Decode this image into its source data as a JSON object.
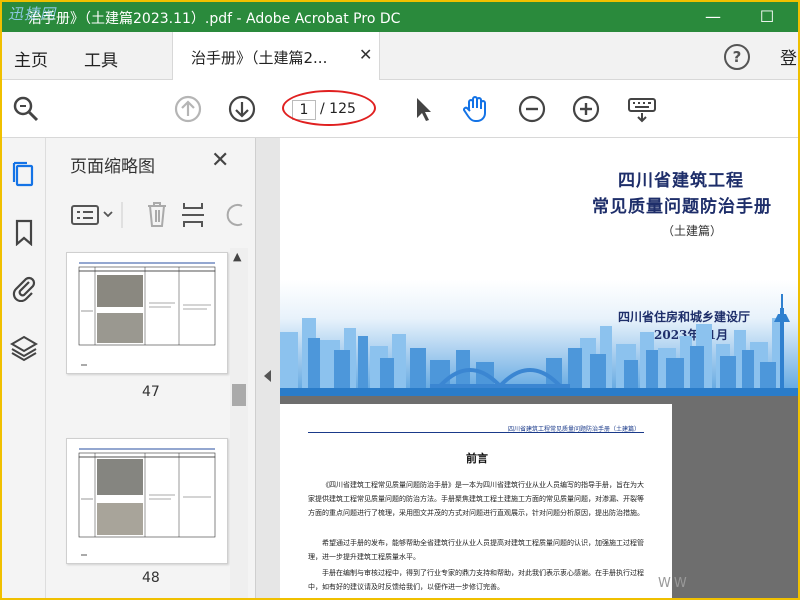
{
  "window": {
    "title": "治手册》（土建篇2023.11）.pdf - Adobe Acrobat Pro DC",
    "watermark": "迅捷网",
    "minimize": "—",
    "maximize": "☐"
  },
  "tabbar": {
    "home": "主页",
    "tools": "工具",
    "doc_tab": "治手册》（土建篇2...",
    "close": "✕",
    "help": "?",
    "signin": "登"
  },
  "toolbar": {
    "current_page": "1",
    "total_pages": "/ 125"
  },
  "panel": {
    "title": "页面缩略图",
    "close": "✕",
    "thumbnails": [
      {
        "page": "47"
      },
      {
        "page": "48"
      }
    ]
  },
  "cover": {
    "title_line1": "四川省建筑工程",
    "title_line2": "常见质量问题防治手册",
    "subtitle": "（土建篇）",
    "org": "四川省住房和城乡建设厅",
    "date": "2023年11月"
  },
  "page2": {
    "header": "四川省建筑工程常见质量问题防治手册（土建篇）",
    "title": "前言",
    "paragraphs": [
      "《四川省建筑工程常见质量问题防治手册》是一本为四川省建筑行业从业人员编写的指导手册，旨在为大家提供建筑工程常见质量问题的防治方法。手册聚焦建筑工程土建施工方面的常见质量问题，对渗漏、开裂等方面的重点问题进行了梳理，采用图文并茂的方式对问题进行直观展示，针对问题分析原因，提出防治措施。",
      "希望通过手册的发布，能够帮助全省建筑行业从业人员提高对建筑工程质量问题的认识，加强施工过程管理，进一步提升建筑工程质量水平。",
      "手册在编制与审核过程中，得到了行业专家的鼎力支持和帮助，对此我们表示衷心感谢。在手册执行过程中，如有好的建议请及时反馈给我们，以便作进一步修订完善。"
    ]
  },
  "corner_text": "WW",
  "colors": {
    "titlebar": "#2a8a3c",
    "frame": "#f0c000",
    "highlight_ring": "#e02020",
    "accent_blue": "#1473e6",
    "cover_title": "#1e2e6a"
  }
}
